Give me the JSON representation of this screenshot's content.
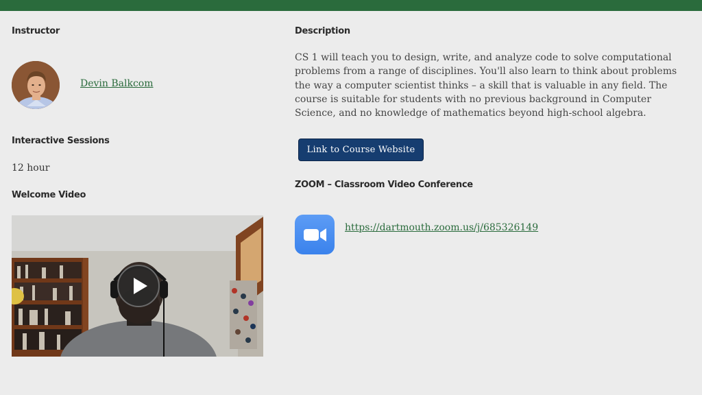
{
  "left": {
    "instructor_heading": "Instructor",
    "instructor_name": "Devin Balkcom",
    "sessions_heading": "Interactive Sessions",
    "sessions_value": "12 hour",
    "video_heading": "Welcome Video"
  },
  "right": {
    "description_heading": "Description",
    "description_text": "CS 1 will teach you to design, write, and analyze code to solve computational problems from a range of disciplines. You'll also learn to think about problems the way a computer scientist thinks – a skill that is valuable in any field. The course is suitable for students with no previous background in Computer Science, and no knowledge of mathematics beyond high-school algebra.",
    "course_button_label": "Link to Course Website",
    "zoom_heading": "ZOOM – Classroom Video Conference",
    "zoom_link": "https://dartmouth.zoom.us/j/685326149"
  },
  "icons": {
    "zoom": "zoom-camera-icon",
    "play": "play-icon"
  },
  "colors": {
    "brand_green": "#2a6b3c",
    "button_blue": "#163d70",
    "zoom_blue": "#3a82ec"
  }
}
